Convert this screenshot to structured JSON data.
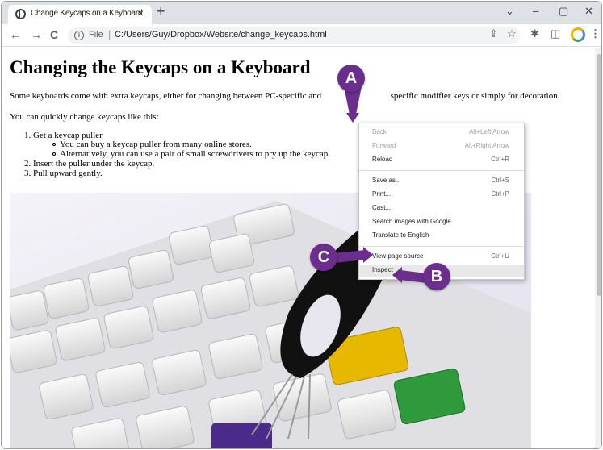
{
  "browser": {
    "tab_title": "Change Keycaps on a Keyboard",
    "tab_close": "×",
    "new_tab": "+",
    "window_controls": [
      "⌄",
      "–",
      "▢",
      "✕"
    ],
    "nav": {
      "back": "←",
      "forward": "→",
      "reload": "C"
    },
    "address": {
      "scheme": "File",
      "url": "C:/Users/Guy/Dropbox/Website/change_keycaps.html"
    },
    "toolbar_icons": [
      "share-icon",
      "star-icon",
      "extensions-icon",
      "sidepanel-icon",
      "profile-avatar",
      "menu-icon"
    ]
  },
  "page": {
    "heading": "Changing the Keycaps on a Keyboard",
    "intro": "Some keyboards come with extra keycaps, either for changing between PC-specific and Mac-specific modifier keys or simply for decoration.",
    "intro_visible": "Some keyboards come with extra keycaps, either for changing between PC-specific and",
    "intro_tail": "specific modifier keys or simply for decoration.",
    "lead": "You can quickly change keycaps like this:",
    "steps": [
      {
        "num": "1.",
        "text": "Get a keycap puller"
      },
      {
        "num": "2.",
        "text": "Insert the puller under the keycap."
      },
      {
        "num": "3.",
        "text": "Pull upward gently."
      }
    ],
    "sub_steps": [
      "You can buy a keycap puller from many online stores.",
      "Alternatively, you can use a pair of small screwdrivers to pry up the keycap."
    ]
  },
  "context_menu": {
    "items": [
      {
        "label": "Back",
        "shortcut": "Alt+Left Arrow",
        "disabled": true
      },
      {
        "label": "Forward",
        "shortcut": "Alt+Right Arrow",
        "disabled": true
      },
      {
        "label": "Reload",
        "shortcut": "Ctrl+R",
        "disabled": false
      },
      {
        "label": "Save as...",
        "shortcut": "Ctrl+S",
        "disabled": false
      },
      {
        "label": "Print...",
        "shortcut": "Ctrl+P",
        "disabled": false
      },
      {
        "label": "Cast...",
        "shortcut": "",
        "disabled": false
      },
      {
        "label": "Search images with Google",
        "shortcut": "",
        "disabled": false
      },
      {
        "label": "Translate to English",
        "shortcut": "",
        "disabled": false
      },
      {
        "label": "View page source",
        "shortcut": "Ctrl+U",
        "disabled": false
      },
      {
        "label": "Inspect",
        "shortcut": "",
        "disabled": false,
        "highlighted": true
      }
    ]
  },
  "callouts": {
    "a": "A",
    "b": "B",
    "c": "C"
  },
  "colors": {
    "callout": "#6b2e8f",
    "tabstrip": "#dee1e6",
    "omnibox": "#f1f3f4"
  }
}
